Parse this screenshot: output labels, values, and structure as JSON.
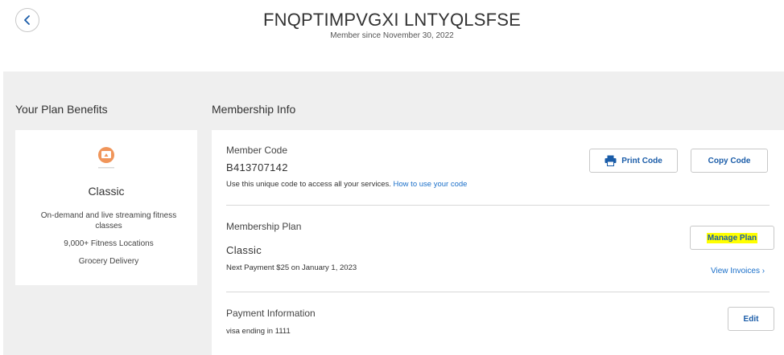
{
  "header": {
    "member_name": "FNQPTIMPVGXI LNTYQLSFSE",
    "member_since": "Member since November 30, 2022"
  },
  "benefits": {
    "section_title": "Your Plan Benefits",
    "plan_name": "Classic",
    "items": [
      "On-demand and live streaming fitness classes",
      "9,000+ Fitness Locations",
      "Grocery Delivery"
    ]
  },
  "membership": {
    "section_title": "Membership Info",
    "member_code": {
      "label": "Member Code",
      "value": "B413707142",
      "help_text": "Use this unique code to access all your services.",
      "help_link": "How to use your code",
      "print_label": "Print Code",
      "copy_label": "Copy Code"
    },
    "plan": {
      "label": "Membership Plan",
      "value": "Classic",
      "next_payment": "Next Payment $25 on January 1, 2023",
      "manage_label": "Manage Plan",
      "invoices_label": "View Invoices ›"
    },
    "payment": {
      "label": "Payment Information",
      "value": "visa ending in 1111",
      "edit_label": "Edit"
    }
  },
  "colors": {
    "link": "#1a6fc9",
    "highlight": "#ffff00",
    "panel_bg": "#efefef",
    "plan_icon": "#f0955a"
  },
  "icons": {
    "back": "chevron-left-icon",
    "plan": "streaming-plan-icon",
    "print": "printer-icon"
  }
}
